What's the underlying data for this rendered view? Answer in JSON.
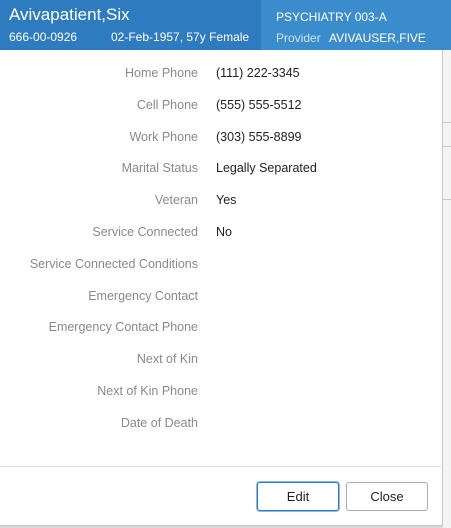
{
  "header": {
    "patient_name": "Avivapatient,Six",
    "ssn": "666-00-0926",
    "dob_age_sex": "02-Feb-1957, 57y Female",
    "location": "PSYCHIATRY 003-A",
    "provider_label": "Provider",
    "provider_name": "AVIVAUSER,FIVE"
  },
  "details": [
    {
      "label": "Home Phone",
      "value": "(111) 222-3345"
    },
    {
      "label": "Cell Phone",
      "value": "(555) 555-5512"
    },
    {
      "label": "Work Phone",
      "value": "(303) 555-8899"
    },
    {
      "label": "Marital Status",
      "value": "Legally Separated"
    },
    {
      "label": "Veteran",
      "value": "Yes"
    },
    {
      "label": "Service Connected",
      "value": "No"
    },
    {
      "label": "Service Connected Conditions",
      "value": ""
    },
    {
      "label": "Emergency Contact",
      "value": ""
    },
    {
      "label": "Emergency Contact Phone",
      "value": ""
    },
    {
      "label": "Next of Kin",
      "value": ""
    },
    {
      "label": "Next of Kin Phone",
      "value": ""
    },
    {
      "label": "Date of Death",
      "value": ""
    }
  ],
  "buttons": {
    "edit": "Edit",
    "close": "Close"
  },
  "colors": {
    "header_bg": "#2e7bbf",
    "header_right_bg": "#3b8ccc",
    "label_text": "#8a8a8a",
    "value_text": "#222222",
    "focus_border": "#2e7bbf"
  }
}
